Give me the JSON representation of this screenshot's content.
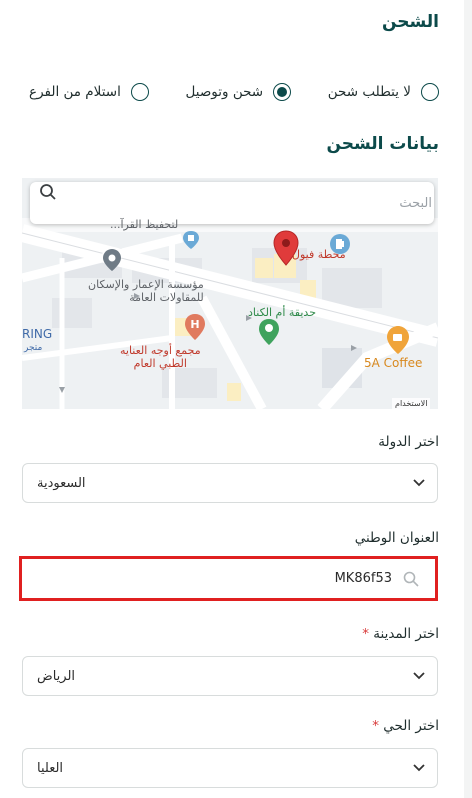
{
  "shipping": {
    "title": "الشحن",
    "options": [
      {
        "label": "لا يتطلب شحن",
        "selected": false
      },
      {
        "label": "شحن وتوصيل",
        "selected": true
      },
      {
        "label": "استلام من الفرع",
        "selected": false
      }
    ]
  },
  "shipping_data": {
    "title": "بيانات الشحن",
    "map": {
      "search_placeholder": "البحث",
      "labels": {
        "fuel_station": "محطة فيول",
        "garden": "حديقة أم الكناد",
        "company_line1": "مؤسسة الإعمار والإسكان",
        "company_line2": "للمقاولات العامة",
        "clinic_line1": "مجمع أوجه العنايه",
        "clinic_line2": "الطبي العام",
        "cafe": "5A Coffee",
        "top_label": "لتحفيظ القرآ...",
        "left_cut_1": "RING",
        "left_cut_2": "متجر",
        "footer": "الاستخدام"
      }
    },
    "country": {
      "label": "اختر الدولة",
      "value": "السعودية"
    },
    "national_address": {
      "label": "العنوان الوطني",
      "value": "MK86f53"
    },
    "city": {
      "label": "اختر المدينة",
      "required_mark": "*",
      "value": "الرياض"
    },
    "district": {
      "label": "اختر الحي",
      "required_mark": "*",
      "value": "العليا"
    }
  },
  "colors": {
    "accent": "#0c4a4a",
    "highlight": "#e02020",
    "required": "#d83a3a"
  },
  "icons": [
    "search-icon",
    "chevron-down-icon",
    "map-pin-icon",
    "fuel-icon",
    "park-icon",
    "hospital-icon",
    "cafe-icon"
  ]
}
